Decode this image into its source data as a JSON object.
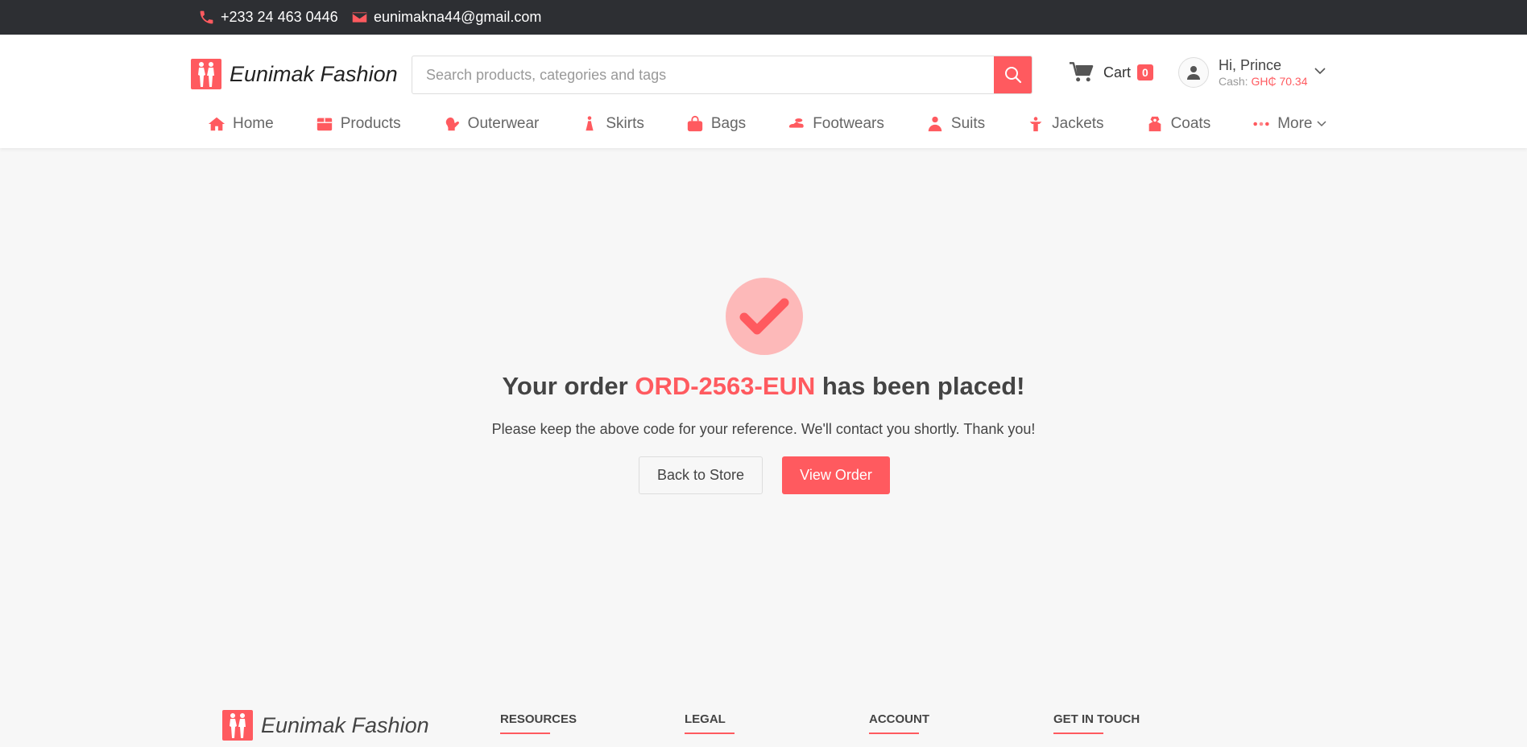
{
  "topbar": {
    "phone": "+233 24 463 0446",
    "email": "eunimakna44@gmail.com"
  },
  "brand": {
    "name": "Eunimak Fashion"
  },
  "search": {
    "placeholder": "Search products, categories and tags"
  },
  "cart": {
    "label": "Cart",
    "count": "0"
  },
  "user": {
    "greeting": "Hi, Prince",
    "cash_label": "Cash:",
    "cash_amount": "GH₵ 70.34"
  },
  "nav": {
    "items": [
      {
        "label": "Home",
        "icon": "home-icon"
      },
      {
        "label": "Products",
        "icon": "box-icon"
      },
      {
        "label": "Outerwear",
        "icon": "mitten-icon"
      },
      {
        "label": "Skirts",
        "icon": "dress-icon"
      },
      {
        "label": "Bags",
        "icon": "bag-icon"
      },
      {
        "label": "Footwears",
        "icon": "shoe-icon"
      },
      {
        "label": "Suits",
        "icon": "suit-icon"
      },
      {
        "label": "Jackets",
        "icon": "jacket-icon"
      },
      {
        "label": "Coats",
        "icon": "coat-icon"
      },
      {
        "label": "More",
        "icon": "dots-icon"
      }
    ]
  },
  "order": {
    "prefix": "Your order",
    "code": "ORD-2563-EUN",
    "suffix": "has been placed!",
    "message": "Please keep the above code for your reference. We'll contact you shortly. Thank you!",
    "back_label": "Back to Store",
    "view_label": "View Order"
  },
  "footer": {
    "brand": "Eunimak Fashion",
    "columns": [
      "RESOURCES",
      "LEGAL",
      "ACCOUNT",
      "GET IN TOUCH"
    ]
  },
  "colors": {
    "accent": "#ff5a5f",
    "topbar": "#2d2f33"
  }
}
